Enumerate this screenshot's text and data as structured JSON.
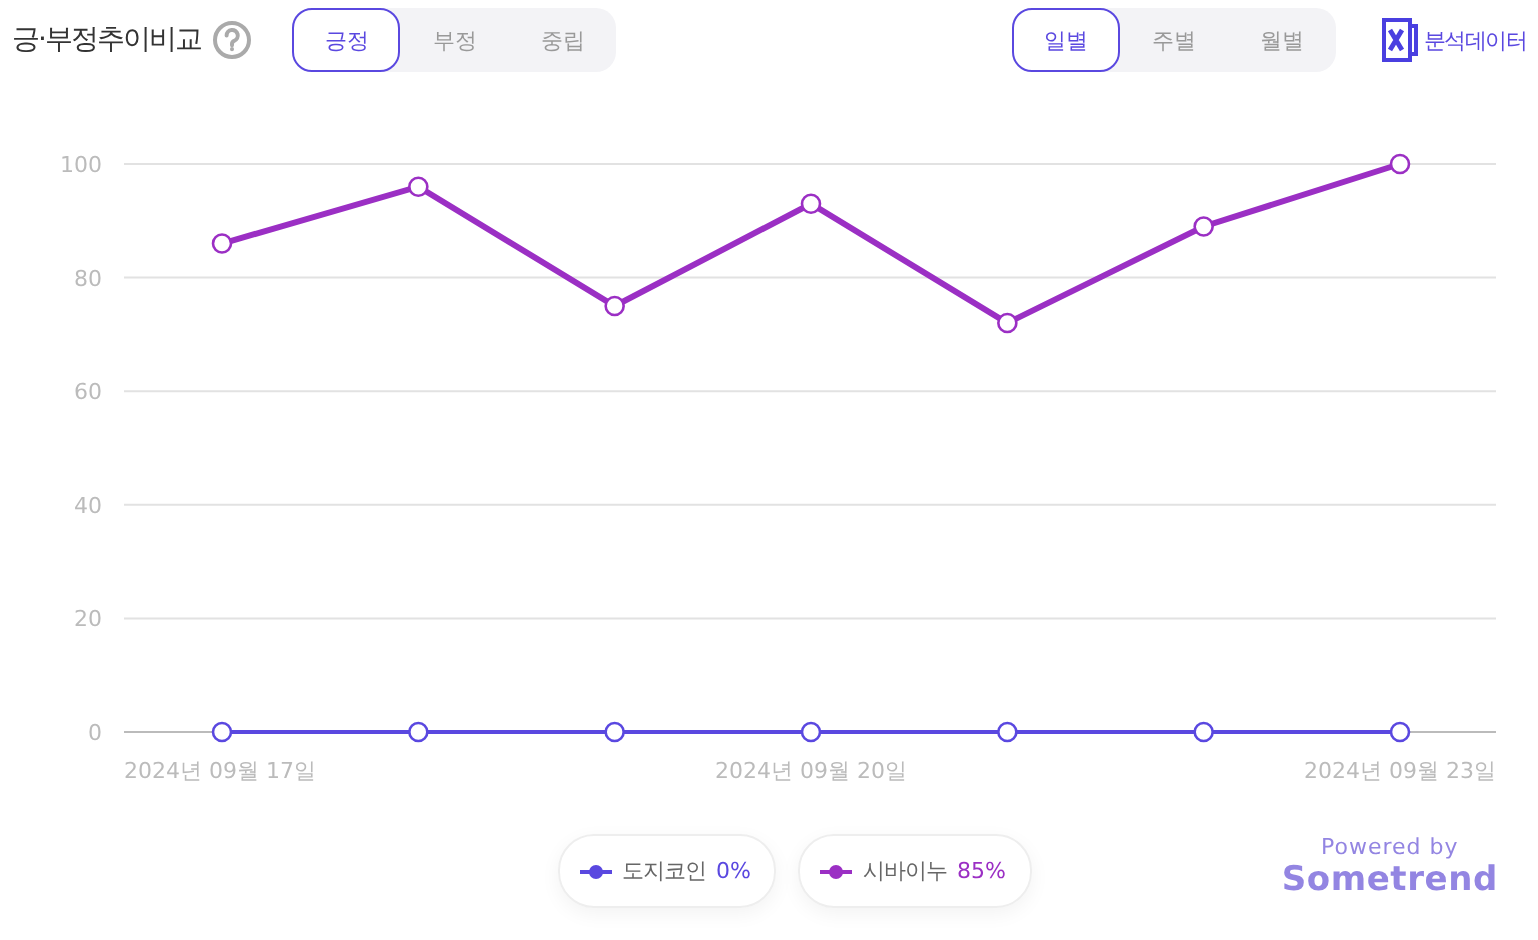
{
  "title": "긍·부정추이비교",
  "sentiment_tabs": [
    {
      "label": "긍정",
      "selected": true
    },
    {
      "label": "부정",
      "selected": false
    },
    {
      "label": "중립",
      "selected": false
    }
  ],
  "period_tabs": [
    {
      "label": "일별",
      "selected": true
    },
    {
      "label": "주별",
      "selected": false
    },
    {
      "label": "월별",
      "selected": false
    }
  ],
  "export_label": "분석데이터",
  "chart_data": {
    "type": "line",
    "categories": [
      "2024년 09월 17일",
      null,
      null,
      "2024년 09월 20일",
      null,
      null,
      "2024년 09월 23일"
    ],
    "ylim": [
      0,
      100
    ],
    "grid": true,
    "yticks": [
      0,
      20,
      40,
      60,
      80,
      100
    ],
    "series": [
      {
        "name": "도지코인",
        "color": "#5a48e0",
        "marker": "circle",
        "values": [
          0,
          0,
          0,
          0,
          0,
          0,
          0
        ]
      },
      {
        "name": "시바이누",
        "color": "#9b2fc4",
        "marker": "circle",
        "values": [
          86,
          96,
          75,
          93,
          72,
          89,
          100
        ]
      }
    ]
  },
  "legend_values": [
    "0%",
    "85%"
  ],
  "powered_by": "Powered by",
  "brand": "Sometrend"
}
